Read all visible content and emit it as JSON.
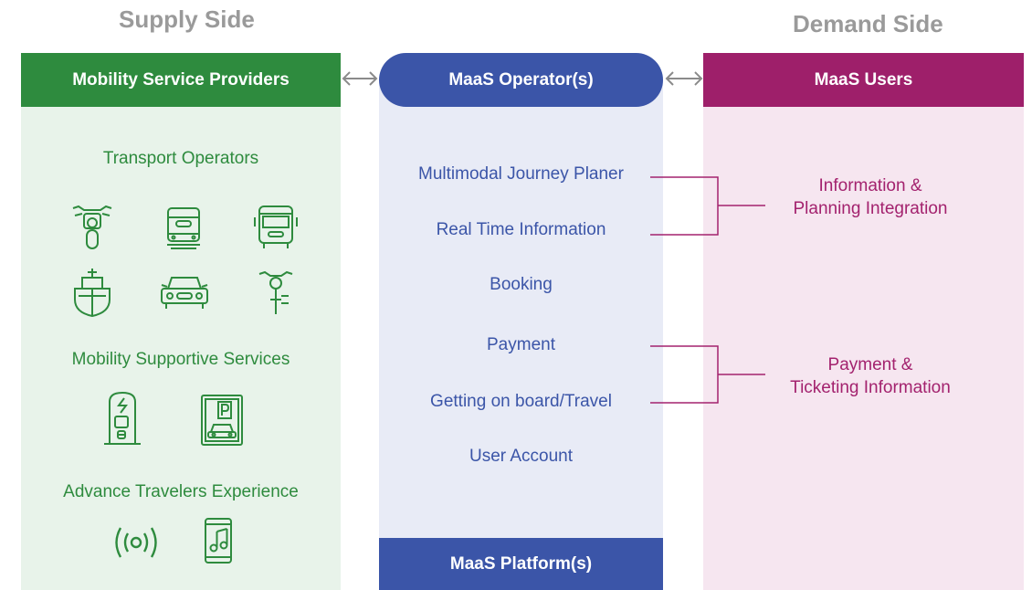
{
  "supply": {
    "title": "Supply Side",
    "header": "Mobility Service Providers",
    "transport_title": "Transport Operators",
    "supportive_title": "Mobility Supportive Services",
    "advance_title": "Advance Travelers Experience"
  },
  "operator": {
    "header": "MaaS Operator(s)",
    "items": [
      "Multimodal Journey Planer",
      "Real Time Information",
      "Booking",
      "Payment",
      "Getting on board/Travel",
      "User Account"
    ],
    "platform": "MaaS Platform(s)"
  },
  "demand": {
    "title": "Demand Side",
    "header": "MaaS Users",
    "group1": [
      "Information &",
      "Planning Integration"
    ],
    "group2": [
      "Payment &",
      "Ticketing Information"
    ]
  },
  "colors": {
    "green": "#2e8b3e",
    "green_bg": "#e8f3ea",
    "blue": "#3b55a8",
    "blue_bg": "#e8ebf6",
    "magenta": "#9e1f6a",
    "pink_bg": "#f6e6f0",
    "title_gray": "#9a9a9a"
  },
  "icons": [
    "motorcycle-icon",
    "tram-icon",
    "bus-icon",
    "ship-icon",
    "car-icon",
    "bicycle-icon",
    "ev-charger-icon",
    "parking-icon",
    "wireless-signal-icon",
    "music-phone-icon"
  ]
}
